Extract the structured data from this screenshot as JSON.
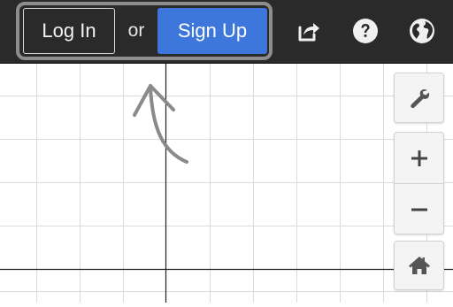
{
  "header": {
    "login_label": "Log In",
    "or_label": "or",
    "signup_label": "Sign Up",
    "icons": [
      "share-icon",
      "help-icon",
      "language-globe-icon"
    ]
  },
  "graph": {
    "grid": true,
    "controls": [
      "graph-settings-wrench-icon",
      "zoom-in-icon",
      "zoom-out-icon",
      "default-view-home-icon"
    ]
  },
  "colors": {
    "header_bg": "#2a2a2a",
    "signup_bg": "#3d77db",
    "highlight_border": "#8d8d8d",
    "grid_line": "#dcdcdc",
    "axis_line": "#222222"
  }
}
